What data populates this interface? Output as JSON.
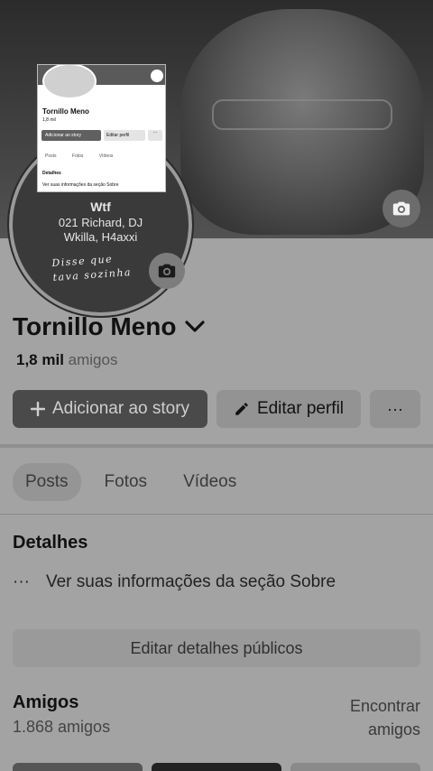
{
  "profile": {
    "name": "Tornillo Meno",
    "friends_count": "1,8 mil",
    "friends_label": "amigos",
    "avatar_text": {
      "line1": "Wtf",
      "line2": "021 Richard, DJ",
      "line3": "Wkilla, H4axxi",
      "handwritten1": "Disse que",
      "handwritten2": "tava sozinha"
    }
  },
  "inset": {
    "name": "Tornillo Meno",
    "friends": "1,8 mil",
    "add_story": "Adicionar ao story",
    "edit_profile": "Editar perfil",
    "more": "···",
    "tab1": "Posts",
    "tab2": "Fotos",
    "tab3": "Vídeos",
    "details": "Detalhes",
    "info": "Ver suas informações da seção Sobre"
  },
  "actions": {
    "add_story": "Adicionar ao story",
    "edit_profile": "Editar perfil",
    "more": "···"
  },
  "tabs": {
    "posts": "Posts",
    "photos": "Fotos",
    "videos": "Vídeos"
  },
  "details": {
    "title": "Detalhes",
    "info": "Ver suas informações da seção Sobre",
    "edit_public": "Editar detalhes públicos"
  },
  "friends": {
    "title": "Amigos",
    "count": "1.868 amigos",
    "find_line1": "Encontrar",
    "find_line2": "amigos"
  },
  "icons": [
    "camera-icon",
    "chevron-down-icon",
    "plus-icon",
    "pencil-icon",
    "more-dots-icon"
  ]
}
